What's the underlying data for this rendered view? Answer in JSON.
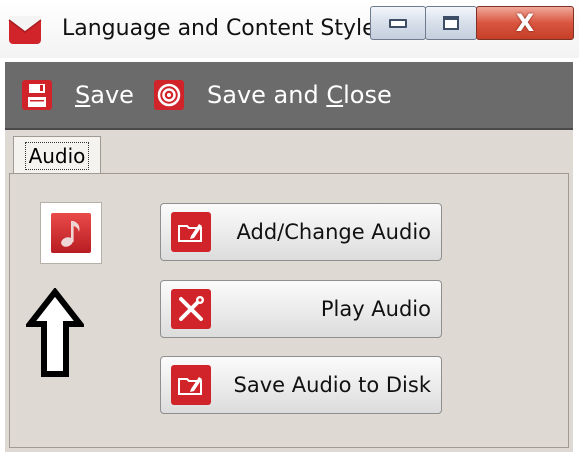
{
  "window": {
    "title": "Language and Content Style",
    "controls": {
      "minimize": "minimize",
      "maximize": "maximize",
      "close": "X"
    }
  },
  "toolbar": {
    "save_underlined": "S",
    "save_rest": "ave",
    "save_close_pre": "Save and ",
    "save_close_underlined": "C",
    "save_close_rest": "lose",
    "icons": {
      "save": "floppy-disk-icon",
      "save_close": "target-icon"
    }
  },
  "tabs": [
    {
      "label": "Audio",
      "selected": true
    }
  ],
  "audio": {
    "preview_icon": "music-note-icon",
    "buttons": [
      {
        "label": "Add/Change Audio",
        "icon": "folder-edit-icon"
      },
      {
        "label": "Play Audio",
        "icon": "tools-icon"
      },
      {
        "label": "Save Audio to Disk",
        "icon": "folder-edit-icon"
      }
    ]
  },
  "colors": {
    "accent_red": "#d1242a",
    "toolbar_bg": "#6b6b6b",
    "panel_bg": "#dedad3"
  }
}
